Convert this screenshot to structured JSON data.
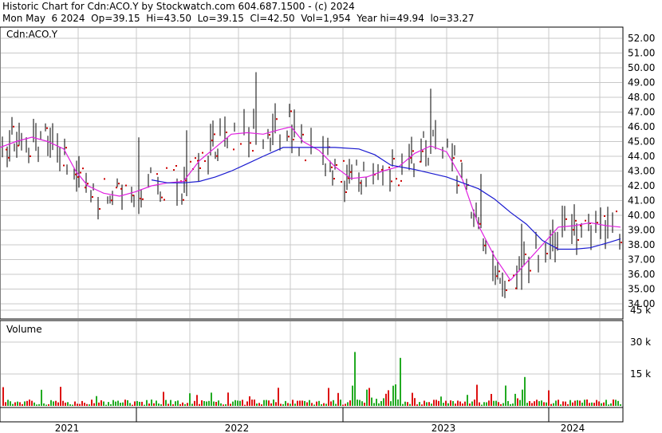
{
  "header": {
    "line1": "Historic Chart for Cdn:ACO.Y by Stockwatch.com 604.687.1500 - (c) 2024",
    "line2": "Mon May  6 2024  Op=39.15  Hi=43.50  Lo=39.15  Cl=42.50  Vol=1,954  Year hi=49.94  lo=33.27"
  },
  "price_panel": {
    "label": "Cdn:ACO.Y"
  },
  "volume_panel": {
    "label": "Volume"
  },
  "colors": {
    "background": "#ffffff",
    "grid": "#c8c8c8",
    "bar": "#000000",
    "close_dot": "#cc0000",
    "ma_short": "#e020e0",
    "ma_long": "#1a1ad0",
    "volume_up": "#22aa22",
    "volume_down": "#dd1111"
  },
  "chart_data": [
    {
      "type": "line",
      "title": "Historic Chart for Cdn:ACO.Y",
      "series_label": "Cdn:ACO.Y",
      "x_labels": [
        "2021",
        "2022",
        "2023",
        "2024"
      ],
      "y_ticks": [
        34,
        35,
        36,
        37,
        38,
        39,
        40,
        41,
        42,
        43,
        44,
        45,
        46,
        47,
        48,
        49,
        50,
        51,
        52
      ],
      "ylim": [
        33,
        52.5
      ],
      "grid": true,
      "moving_averages": [
        {
          "color": "magenta",
          "points": [
            [
              0,
              44.6
            ],
            [
              20,
              45
            ],
            [
              40,
              45.3
            ],
            [
              60,
              45
            ],
            [
              80,
              44.5
            ],
            [
              95,
              43
            ],
            [
              110,
              42
            ],
            [
              130,
              41.5
            ],
            [
              150,
              41.3
            ],
            [
              170,
              41.6
            ],
            [
              190,
              42
            ],
            [
              210,
              42.2
            ],
            [
              230,
              42.3
            ],
            [
              250,
              43.7
            ],
            [
              270,
              44.6
            ],
            [
              290,
              45.5
            ],
            [
              310,
              45.6
            ],
            [
              330,
              45.5
            ],
            [
              350,
              45.8
            ],
            [
              365,
              46
            ],
            [
              380,
              45
            ],
            [
              400,
              44.4
            ],
            [
              420,
              43.3
            ],
            [
              440,
              42.5
            ],
            [
              460,
              42.6
            ],
            [
              480,
              43
            ],
            [
              500,
              43.3
            ],
            [
              520,
              44.2
            ],
            [
              540,
              44.7
            ],
            [
              560,
              44.3
            ],
            [
              580,
              42.4
            ],
            [
              600,
              39.3
            ],
            [
              620,
              37.2
            ],
            [
              640,
              35.6
            ],
            [
              660,
              36.8
            ],
            [
              680,
              38
            ],
            [
              700,
              39.2
            ],
            [
              720,
              39.3
            ],
            [
              740,
              39.5
            ],
            [
              760,
              39.3
            ],
            [
              778,
              39.2
            ]
          ]
        },
        {
          "color": "blue",
          "points": [
            [
              190,
              42.4
            ],
            [
              210,
              42.2
            ],
            [
              230,
              42.2
            ],
            [
              250,
              42.3
            ],
            [
              270,
              42.6
            ],
            [
              290,
              43
            ],
            [
              310,
              43.5
            ],
            [
              330,
              44
            ],
            [
              355,
              44.6
            ],
            [
              380,
              44.6
            ],
            [
              420,
              44.6
            ],
            [
              450,
              44.5
            ],
            [
              470,
              44.1
            ],
            [
              490,
              43.4
            ],
            [
              520,
              43.1
            ],
            [
              560,
              42.6
            ],
            [
              580,
              42.2
            ],
            [
              600,
              41.8
            ],
            [
              620,
              41.1
            ],
            [
              640,
              40.2
            ],
            [
              660,
              39.4
            ],
            [
              680,
              38.3
            ],
            [
              700,
              37.7
            ],
            [
              720,
              37.7
            ],
            [
              740,
              37.8
            ],
            [
              760,
              38.1
            ],
            [
              778,
              38.4
            ]
          ]
        }
      ]
    },
    {
      "type": "bar",
      "title": "Volume",
      "y_ticks": [
        "15 k",
        "30 k",
        "45 k"
      ],
      "ylim": [
        0,
        50
      ]
    }
  ]
}
